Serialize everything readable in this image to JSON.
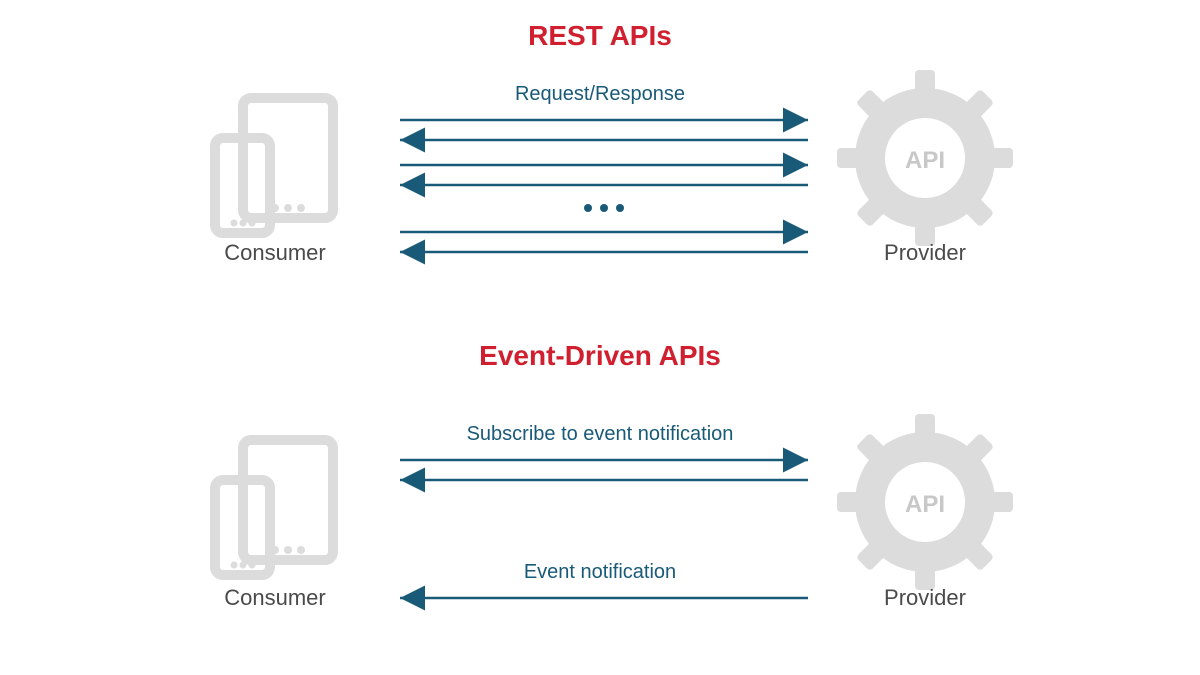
{
  "colors": {
    "accent": "#d02030",
    "arrow": "#185a78",
    "muted": "#dcdcdc",
    "text": "#4a4a4a"
  },
  "diagram": {
    "rest": {
      "title": "REST APIs",
      "consumer_label": "Consumer",
      "provider_label": "Provider",
      "api_badge": "API",
      "arrow_label": "Request/Response",
      "ellipsis": "● ● ●"
    },
    "event": {
      "title": "Event-Driven APIs",
      "consumer_label": "Consumer",
      "provider_label": "Provider",
      "api_badge": "API",
      "subscribe_label": "Subscribe to event notification",
      "notify_label": "Event notification"
    }
  }
}
